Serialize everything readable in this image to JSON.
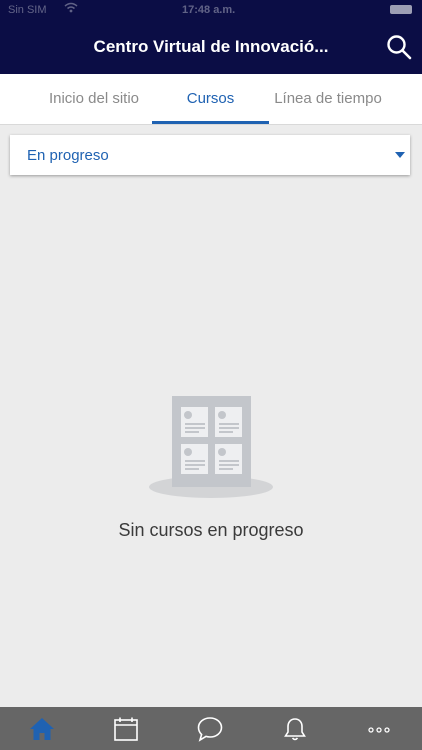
{
  "status_bar": {
    "carrier": "Sin SIM",
    "time": "17:48 a.m."
  },
  "header": {
    "title": "Centro Virtual de Innovació...",
    "search_icon": "search-icon"
  },
  "tabs": [
    {
      "label": "Inicio del sitio",
      "active": false
    },
    {
      "label": "Cursos",
      "active": true
    },
    {
      "label": "Línea de tiempo",
      "active": false
    }
  ],
  "filter": {
    "selected": "En progreso"
  },
  "empty_state": {
    "icon": "courses-grid-icon",
    "message": "Sin cursos en progreso"
  },
  "bottom_nav": {
    "items": [
      {
        "icon": "home-icon",
        "active": true
      },
      {
        "icon": "calendar-icon",
        "active": false
      },
      {
        "icon": "messages-icon",
        "active": false
      },
      {
        "icon": "bell-icon",
        "active": false
      },
      {
        "icon": "more-icon",
        "active": false
      }
    ]
  },
  "colors": {
    "header_bg": "#0b0d45",
    "accent": "#1f62b2",
    "tab_inactive": "#8a8a8a",
    "background": "#ececec",
    "bottom_bar": "#666666"
  }
}
